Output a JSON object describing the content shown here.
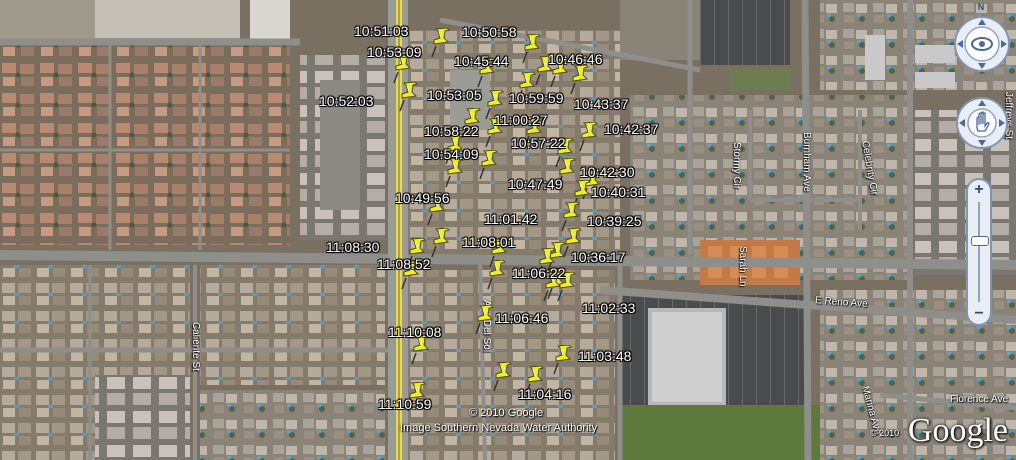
{
  "map": {
    "copyright": "© 2010 Google",
    "imagery_credit": "Image Southern Nevada Water Authority",
    "brand": "Google",
    "small_copyright": "© 2010"
  },
  "streets": {
    "stormy": "Stormy Cir",
    "burnham": "Burnham Ave",
    "celebrity": "Celebrity Cir",
    "jeffreys": "Jeffreys St",
    "reno": "E Reno Ave",
    "sarah": "Sarah Ln",
    "caliente": "Caliente St",
    "delsol": "Ave Del Sol",
    "florence": "Florence Ave",
    "marina": "Marina Ave"
  },
  "timestamps": [
    "10:51:03",
    "10:50:58",
    "10:53:09",
    "10:45:44",
    "10:46:46",
    "10:52:03",
    "10:53:05",
    "10:59:59",
    "10:43:37",
    "11:00:27",
    "10:58:22",
    "10:42:37",
    "10:57:22",
    "10:54:09",
    "10:42:30",
    "10:47:49",
    "10:40:31",
    "10:49:56",
    "10:39:25",
    "11:01:42",
    "11:08:30",
    "11:08:01",
    "10:36:17",
    "11:08:52",
    "11:06:22",
    "11:02:33",
    "11:06:46",
    "11:10:08",
    "11:03:48",
    "11:04:16",
    "11:10:59"
  ],
  "controls": {
    "look_icon": "eye-icon",
    "move_icon": "hand-icon",
    "north_label": "N",
    "zoom_in": "+",
    "zoom_out": "−",
    "zoom_level": 0.62
  },
  "colors": {
    "pin": "#f2ef1e",
    "road": "#8a8a8a",
    "major_road_line": "#f2e22a",
    "label_text": "#ffffff"
  }
}
